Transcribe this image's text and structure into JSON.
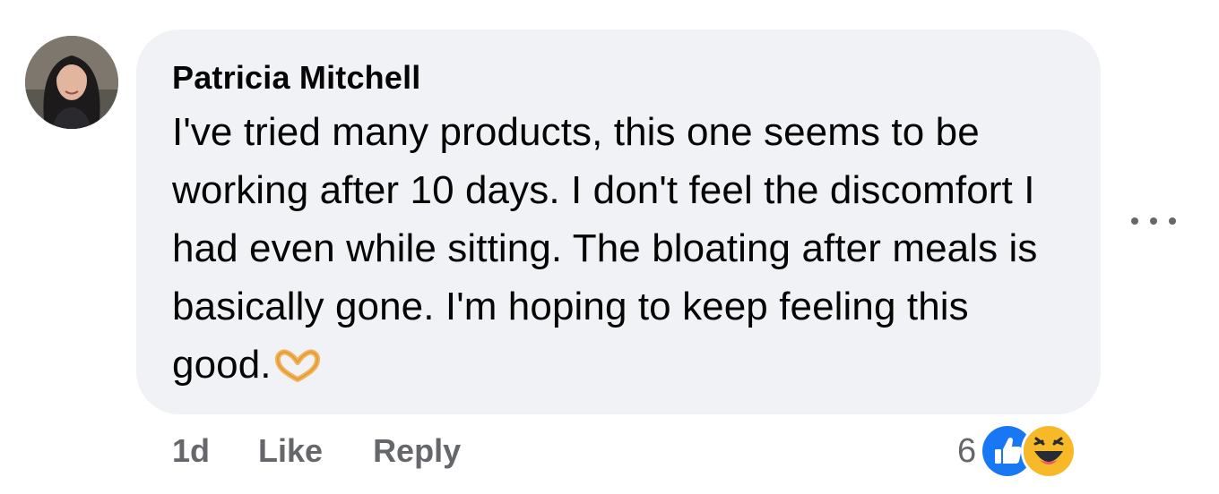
{
  "comment": {
    "author": "Patricia Mitchell",
    "text": "I've tried many products, this one seems to be working after 10 days. I don't feel the discomfort I had even while sitting. The bloating after meals is basically gone. I'm hoping to keep feeling this good.",
    "trailing_emoji": "heart-hands-icon"
  },
  "actions": {
    "time": "1d",
    "like_label": "Like",
    "reply_label": "Reply"
  },
  "reactions": {
    "count": "6",
    "types": [
      "like-icon",
      "haha-icon"
    ]
  },
  "colors": {
    "bubble": "#f0f2f5",
    "muted_text": "#65676b",
    "like_blue": "#1877f2",
    "haha_yellow": "#f7b928"
  }
}
